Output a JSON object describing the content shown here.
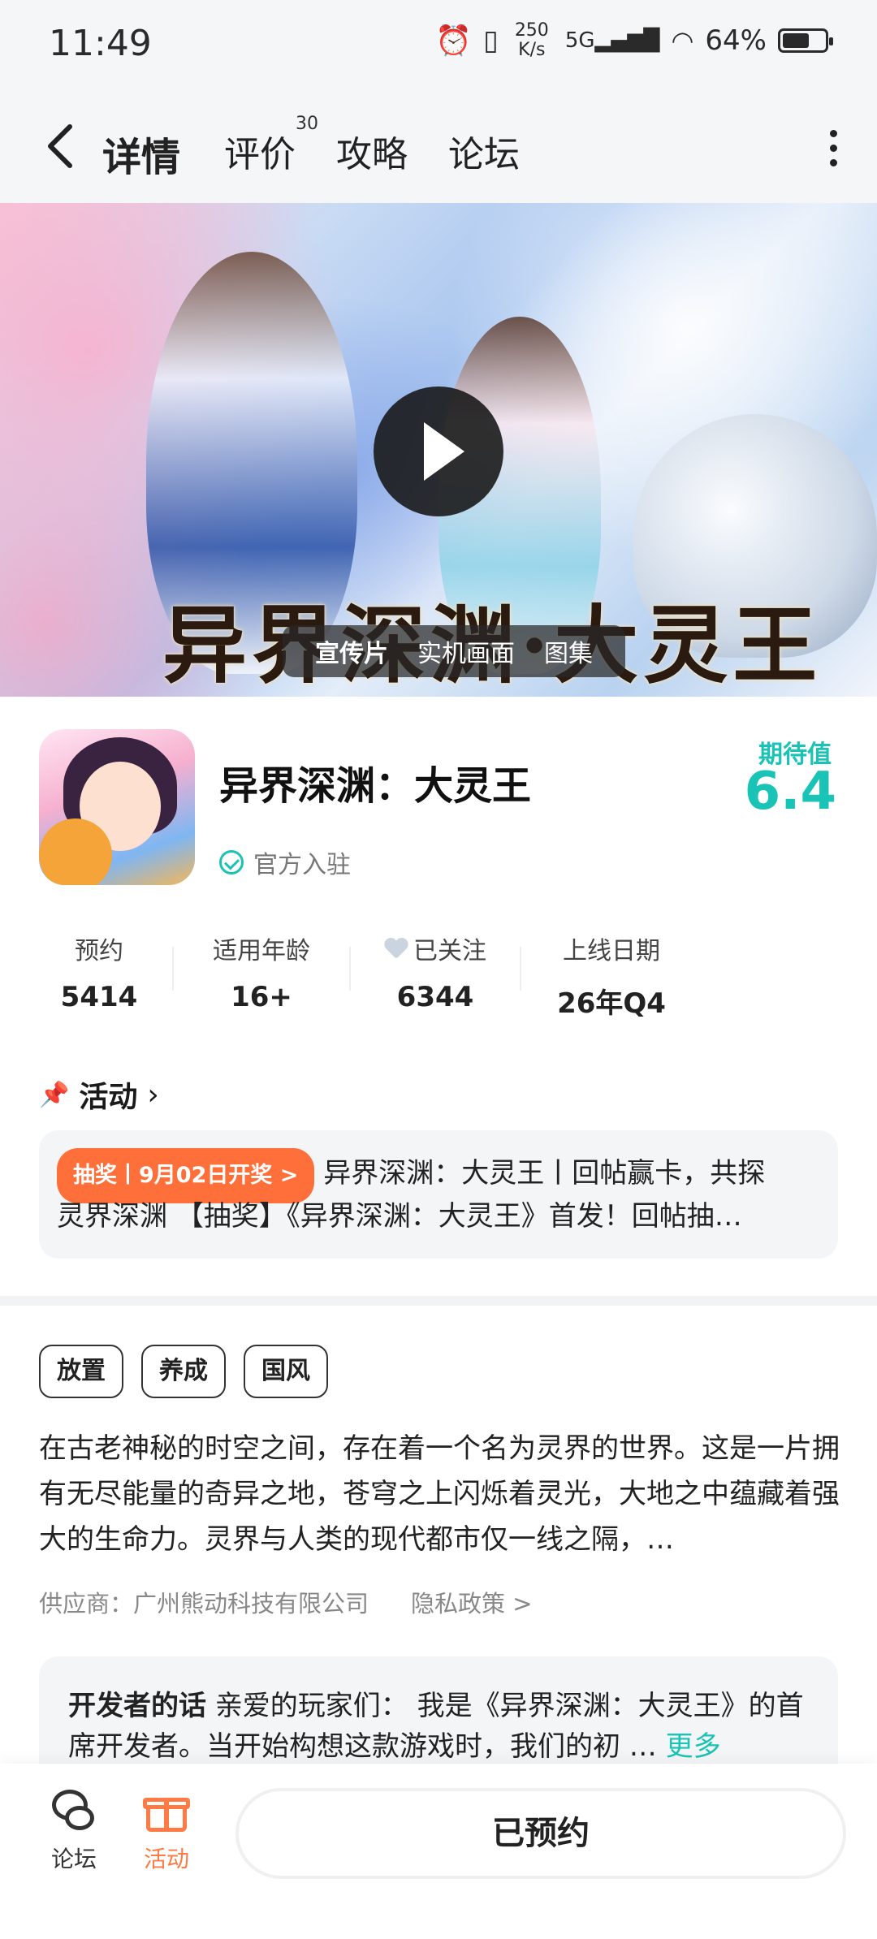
{
  "status_bar": {
    "time": "11:49",
    "net_speed_value": "250",
    "net_speed_unit": "K/s",
    "signal": "5G",
    "battery_percent": "64%",
    "battery_level": 0.64
  },
  "nav": {
    "tabs": [
      {
        "label": "详情",
        "active": true
      },
      {
        "label": "评价",
        "badge": "30"
      },
      {
        "label": "攻略"
      },
      {
        "label": "论坛"
      }
    ]
  },
  "hero": {
    "title_art": "异界深渊·大灵王",
    "media_tabs": [
      "宣传片",
      "实机画面",
      "图集"
    ]
  },
  "game": {
    "name": "异界深渊：大灵王",
    "verified_label": "官方入驻",
    "expect_label": "期待值",
    "expect_value": "6.4"
  },
  "stats": [
    {
      "label": "预约",
      "value": "5414"
    },
    {
      "label": "适用年龄",
      "value": "16+"
    },
    {
      "label": "已关注",
      "value": "6344"
    },
    {
      "label": "上线日期",
      "value": "26年Q4"
    }
  ],
  "activity": {
    "title": "活动",
    "badge": "抽奖丨9月02日开奖 >",
    "line1": "异界深渊：大灵王丨回帖赢卡，共探",
    "line2": "灵界深渊 【抽奖】《异界深渊：大灵王》首发！回帖抽…"
  },
  "tags": [
    "放置",
    "养成",
    "国风"
  ],
  "description": "在古老神秘的时空之间，存在着一个名为灵界的世界。这是一片拥有无尽能量的奇异之地，苍穹之上闪烁着灵光，大地之中蕴藏着强大的生命力。灵界与人类的现代都市仅一线之隔，…",
  "supplier": "供应商：广州熊动科技有限公司",
  "privacy": "隐私政策 >",
  "developer": {
    "title": "开发者的话",
    "text": "亲爱的玩家们： 我是《异界深渊：大灵王》的首席开发者。当开始构想这款游戏时，我们的初 …",
    "more": "更多"
  },
  "bottom_bar": {
    "forum_label": "论坛",
    "activity_label": "活动",
    "reserve_label": "已预约"
  },
  "colors": {
    "accent": "#19c3b5",
    "lottery": "#ff6f3a",
    "gift": "#ff7a45"
  }
}
